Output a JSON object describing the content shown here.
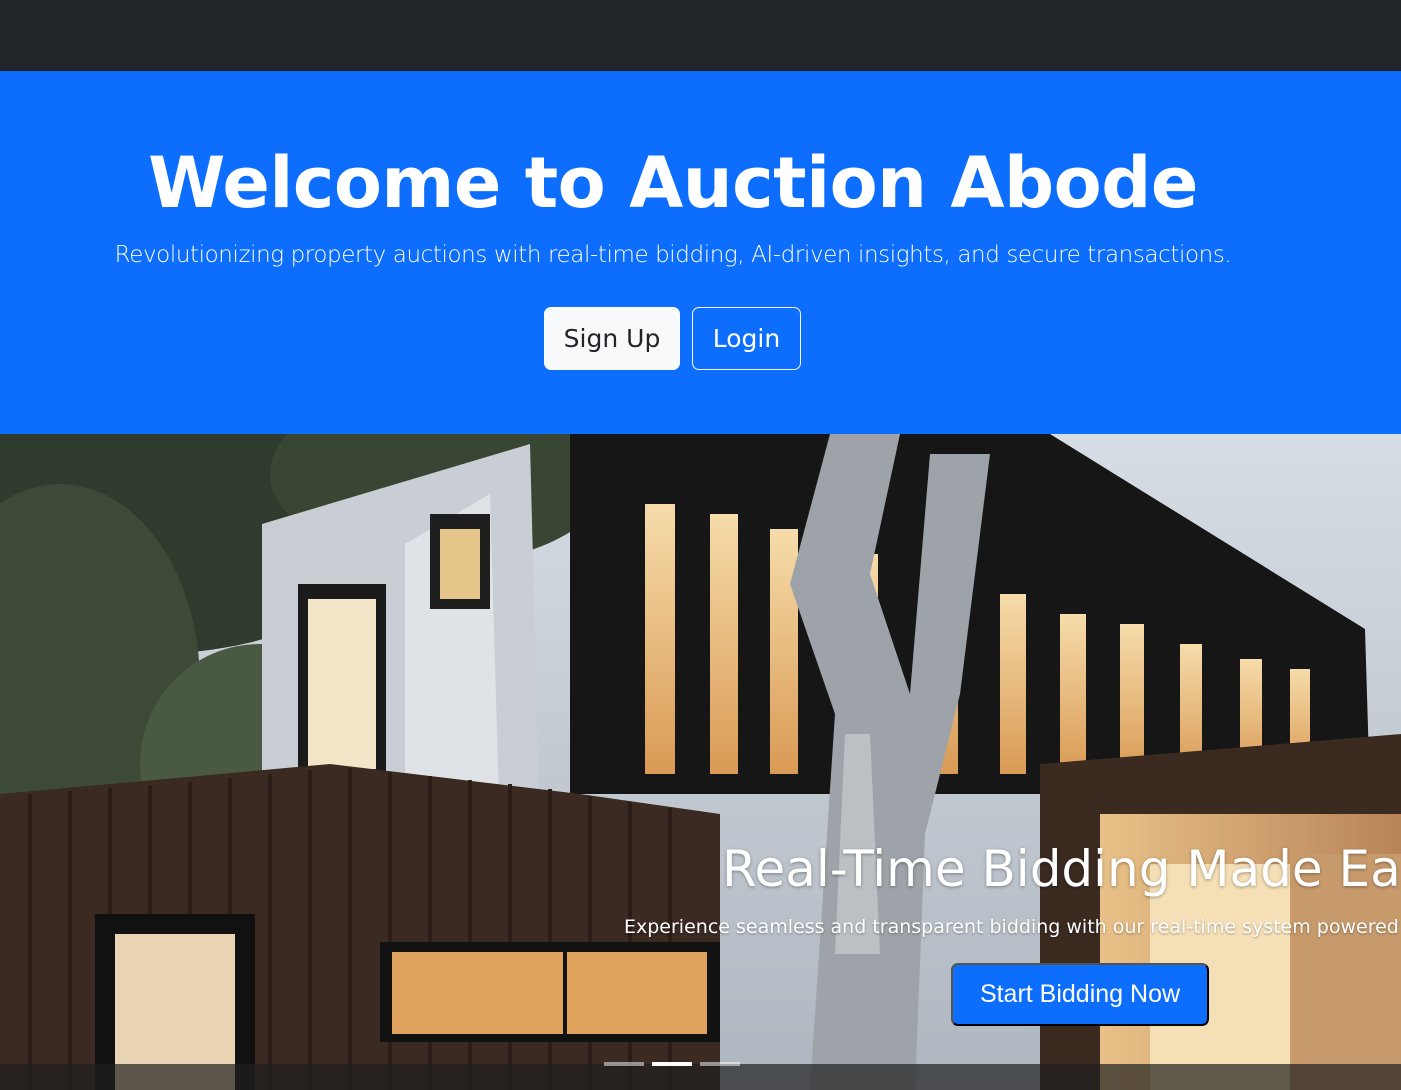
{
  "hero": {
    "title": "Welcome to Auction Abode",
    "subtitle": "Revolutionizing property auctions with real-time bidding, AI-driven insights, and secure transactions.",
    "signup_label": "Sign Up",
    "login_label": "Login"
  },
  "carousel": {
    "image": "modern-house-photo",
    "caption_title": "Real-Time Bidding Made Eas",
    "caption_text": "Experience seamless and transparent bidding with our real-time system powered b",
    "button_label": "Start Bidding Now",
    "slide_count": 3,
    "active_slide": 2
  },
  "colors": {
    "navbar": "#212529",
    "primary": "#0d6efd",
    "light": "#f8f9fa"
  }
}
